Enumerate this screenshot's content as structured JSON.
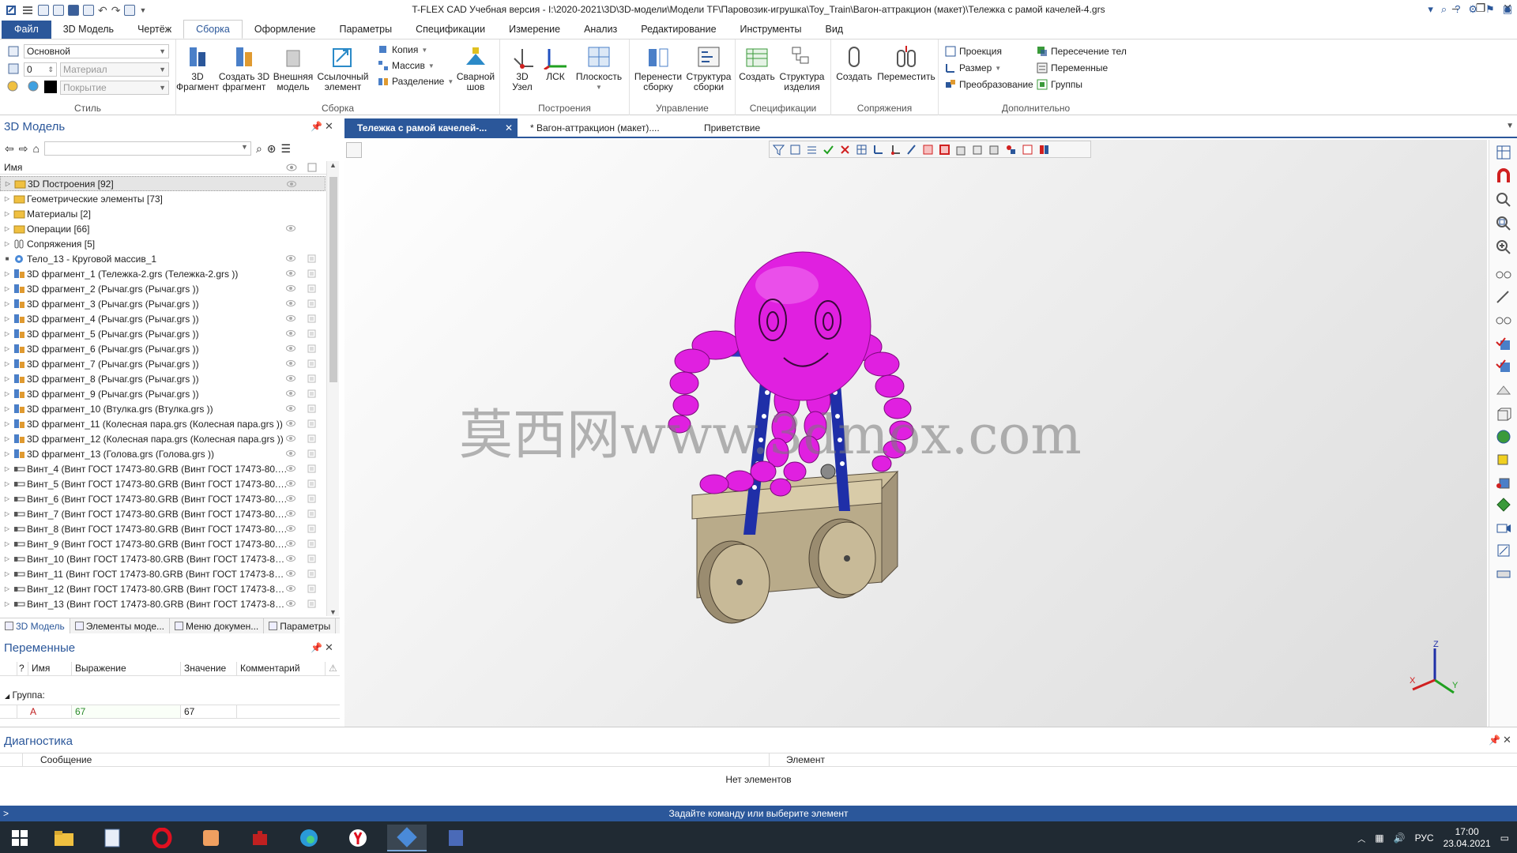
{
  "app": {
    "title": "T-FLEX CAD Учебная версия - I:\\2020-2021\\3D\\3D-модели\\Модели TF\\Паровозик-игрушка\\Toy_Train\\Вагон-аттракцион (макет)\\Тележка с рамой качелей-4.grs"
  },
  "menu": {
    "items": [
      "Файл",
      "3D Модель",
      "Чертёж",
      "Сборка",
      "Оформление",
      "Параметры",
      "Спецификации",
      "Измерение",
      "Анализ",
      "Редактирование",
      "Инструменты",
      "Вид"
    ],
    "active_index": 3
  },
  "ribbon": {
    "style": {
      "label": "Стиль",
      "layer_value": "Основной",
      "number_value": "0",
      "material_placeholder": "Материал",
      "coating_placeholder": "Покрытие"
    },
    "assembly": {
      "label": "Сборка",
      "btn_3d_fragment": "3D\nФрагмент",
      "btn_create_fragment": "Создать 3D\nфрагмент",
      "btn_external_model": "Внешняя\nмодель",
      "btn_reference": "Ссылочный\nэлемент",
      "copy": "Копия",
      "array": "Массив",
      "split": "Разделение",
      "weld": "Сварной\nшов"
    },
    "construct": {
      "label": "Построения",
      "node": "3D\nУзел",
      "lcs": "ЛСК",
      "plane": "Плоскость"
    },
    "manage": {
      "label": "Управление",
      "rebuild": "Перенести\nсборку",
      "structure": "Структура\nсборки"
    },
    "spec": {
      "label": "Спецификации",
      "create": "Создать",
      "product_structure": "Структура\nизделия"
    },
    "mates": {
      "label": "Сопряжения",
      "create": "Создать",
      "move": "Переместить"
    },
    "extra": {
      "label": "Дополнительно",
      "projection": "Проекция",
      "size": "Размер",
      "transform": "Преобразование",
      "intersection": "Пересечение тел",
      "variables": "Переменные",
      "groups": "Группы"
    }
  },
  "model_panel": {
    "title": "3D Модель",
    "column_name": "Имя",
    "items": [
      {
        "label": "3D Построения [92]",
        "icon": "folder",
        "eye": true
      },
      {
        "label": "Геометрические элементы [73]",
        "icon": "folder",
        "eye": false
      },
      {
        "label": "Материалы [2]",
        "icon": "folder",
        "eye": false
      },
      {
        "label": "Операции [66]",
        "icon": "folder",
        "eye": true
      },
      {
        "label": "Сопряжения [5]",
        "icon": "mate",
        "eye": false
      },
      {
        "label": "Тело_13 - Круговой массив_1",
        "icon": "body",
        "eye": true
      },
      {
        "label": "3D фрагмент_1 (Тележка-2.grs (Тележка-2.grs ))",
        "icon": "fragment",
        "eye": true
      },
      {
        "label": "3D фрагмент_2 (Рычаг.grs (Рычаг.grs ))",
        "icon": "fragment",
        "eye": true
      },
      {
        "label": "3D фрагмент_3 (Рычаг.grs (Рычаг.grs ))",
        "icon": "fragment",
        "eye": true
      },
      {
        "label": "3D фрагмент_4 (Рычаг.grs (Рычаг.grs ))",
        "icon": "fragment",
        "eye": true
      },
      {
        "label": "3D фрагмент_5 (Рычаг.grs (Рычаг.grs ))",
        "icon": "fragment",
        "eye": true
      },
      {
        "label": "3D фрагмент_6 (Рычаг.grs (Рычаг.grs ))",
        "icon": "fragment",
        "eye": true
      },
      {
        "label": "3D фрагмент_7 (Рычаг.grs (Рычаг.grs ))",
        "icon": "fragment",
        "eye": true
      },
      {
        "label": "3D фрагмент_8 (Рычаг.grs (Рычаг.grs ))",
        "icon": "fragment",
        "eye": true
      },
      {
        "label": "3D фрагмент_9 (Рычаг.grs (Рычаг.grs ))",
        "icon": "fragment",
        "eye": true
      },
      {
        "label": "3D фрагмент_10 (Втулка.grs (Втулка.grs ))",
        "icon": "fragment",
        "eye": true
      },
      {
        "label": "3D фрагмент_11 (Колесная пара.grs (Колесная пара.grs ))",
        "icon": "fragment",
        "eye": true
      },
      {
        "label": "3D фрагмент_12 (Колесная пара.grs (Колесная пара.grs ))",
        "icon": "fragment",
        "eye": true
      },
      {
        "label": "3D фрагмент_13 (Голова.grs (Голова.grs ))",
        "icon": "fragment",
        "eye": true
      },
      {
        "label": "Винт_4 (Винт ГОСТ 17473-80.GRB (Винт ГОСТ 17473-80.GR...",
        "icon": "screw",
        "eye": true
      },
      {
        "label": "Винт_5 (Винт ГОСТ 17473-80.GRB (Винт ГОСТ 17473-80.GR...",
        "icon": "screw",
        "eye": true
      },
      {
        "label": "Винт_6 (Винт ГОСТ 17473-80.GRB (Винт ГОСТ 17473-80.GR...",
        "icon": "screw",
        "eye": true
      },
      {
        "label": "Винт_7 (Винт ГОСТ 17473-80.GRB (Винт ГОСТ 17473-80.GR...",
        "icon": "screw",
        "eye": true
      },
      {
        "label": "Винт_8 (Винт ГОСТ 17473-80.GRB (Винт ГОСТ 17473-80.GR...",
        "icon": "screw",
        "eye": true
      },
      {
        "label": "Винт_9 (Винт ГОСТ 17473-80.GRB (Винт ГОСТ 17473-80.GR...",
        "icon": "screw",
        "eye": true
      },
      {
        "label": "Винт_10 (Винт ГОСТ 17473-80.GRB (Винт ГОСТ 17473-80.G...",
        "icon": "screw",
        "eye": true
      },
      {
        "label": "Винт_11 (Винт ГОСТ 17473-80.GRB (Винт ГОСТ 17473-80.G...",
        "icon": "screw",
        "eye": true
      },
      {
        "label": "Винт_12 (Винт ГОСТ 17473-80.GRB (Винт ГОСТ 17473-80.G...",
        "icon": "screw",
        "eye": true
      },
      {
        "label": "Винт_13 (Винт ГОСТ 17473-80.GRB (Винт ГОСТ 17473-80.G...",
        "icon": "screw",
        "eye": true
      }
    ],
    "tabs": [
      "3D Модель",
      "Элементы моде...",
      "Меню докумен...",
      "Параметры"
    ]
  },
  "variables_panel": {
    "title": "Переменные",
    "columns": [
      "?",
      "Имя",
      "Выражение",
      "Значение",
      "Комментарий"
    ],
    "group_label": "Группа:",
    "rows": [
      {
        "name": "A",
        "expression": "67",
        "value": "67",
        "comment": ""
      }
    ]
  },
  "doc_tabs": {
    "items": [
      "Тележка с рамой качелей-...",
      "* Вагон-аттракцион (макет)....",
      "Приветствие"
    ],
    "active_index": 0
  },
  "viewport": {
    "watermark": "莫西网www.3dmox.com",
    "axis_x": "X",
    "axis_y": "Y",
    "axis_z": "Z"
  },
  "diagnostics": {
    "title": "Диагностика",
    "col_message": "Сообщение",
    "col_element": "Элемент",
    "empty_text": "Нет элементов"
  },
  "status": {
    "text": "Задайте команду или выберите элемент"
  },
  "taskbar": {
    "language": "РУС",
    "time": "17:00",
    "date": "23.04.2021"
  },
  "colors": {
    "accent": "#2b579a",
    "model_magenta": "#e020e0",
    "model_blue": "#1f2fa8",
    "model_frame": "#c8b890"
  }
}
